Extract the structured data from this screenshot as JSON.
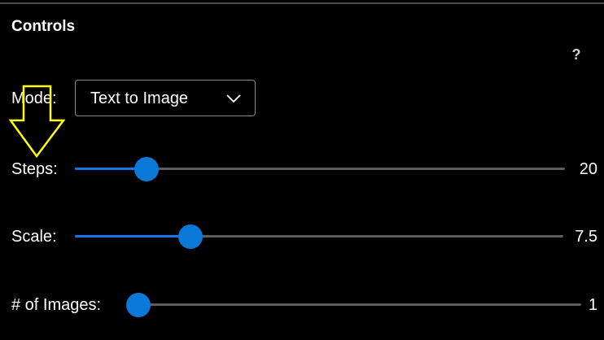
{
  "panel": {
    "title": "Controls",
    "help_label": "?"
  },
  "mode": {
    "label": "Mode:",
    "selected": "Text to Image"
  },
  "sliders": [
    {
      "label": "Steps:",
      "value": "20",
      "fraction": 0.147
    },
    {
      "label": "Scale:",
      "value": "7.5",
      "fraction": 0.237
    },
    {
      "label": "# of Images:",
      "value": "1",
      "fraction": 0.0
    }
  ],
  "annotation": {
    "arrow_color": "#ffff00"
  },
  "colors": {
    "accent": "#0a78d7",
    "track": "#5c5c5c",
    "background": "#000000"
  }
}
